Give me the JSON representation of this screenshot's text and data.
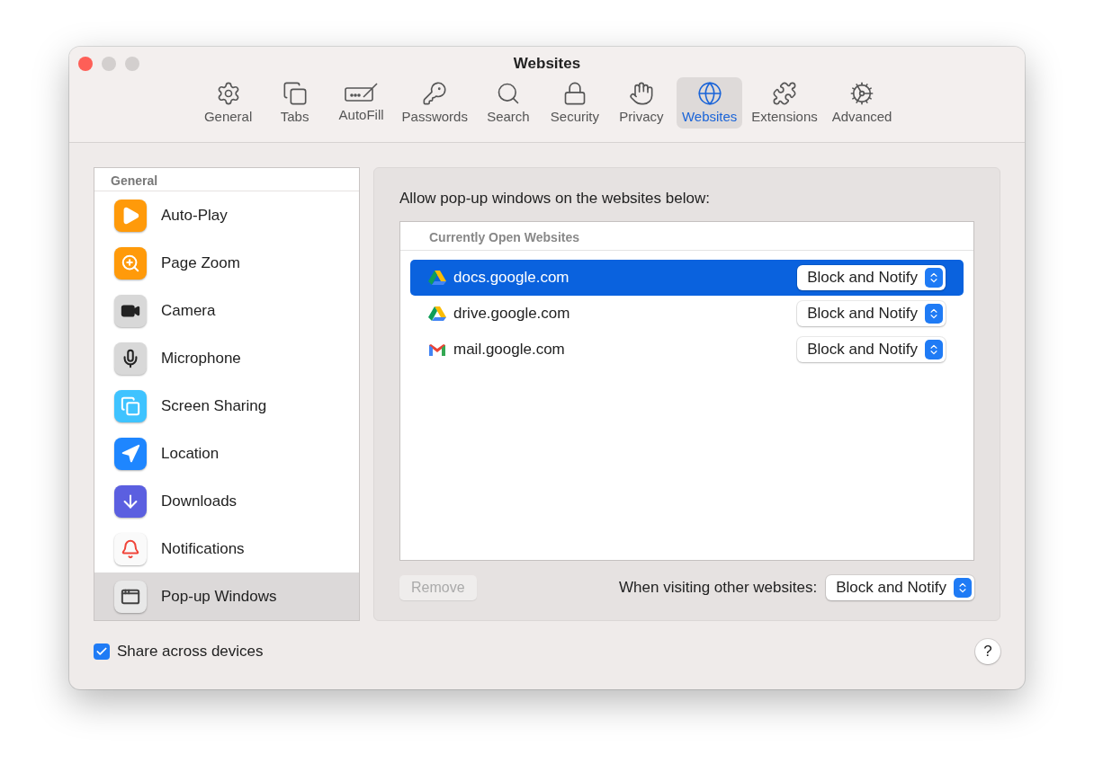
{
  "window": {
    "title": "Websites"
  },
  "tabs": [
    {
      "label": "General",
      "selected": false
    },
    {
      "label": "Tabs",
      "selected": false
    },
    {
      "label": "AutoFill",
      "selected": false
    },
    {
      "label": "Passwords",
      "selected": false
    },
    {
      "label": "Search",
      "selected": false
    },
    {
      "label": "Security",
      "selected": false
    },
    {
      "label": "Privacy",
      "selected": false
    },
    {
      "label": "Websites",
      "selected": true
    },
    {
      "label": "Extensions",
      "selected": false
    },
    {
      "label": "Advanced",
      "selected": false
    }
  ],
  "sidebar": {
    "header": "General",
    "items": [
      {
        "label": "Auto-Play",
        "selected": false
      },
      {
        "label": "Page Zoom",
        "selected": false
      },
      {
        "label": "Camera",
        "selected": false
      },
      {
        "label": "Microphone",
        "selected": false
      },
      {
        "label": "Screen Sharing",
        "selected": false
      },
      {
        "label": "Location",
        "selected": false
      },
      {
        "label": "Downloads",
        "selected": false
      },
      {
        "label": "Notifications",
        "selected": false
      },
      {
        "label": "Pop-up Windows",
        "selected": true
      }
    ]
  },
  "panel": {
    "heading": "Allow pop-up windows on the websites below:",
    "table_header": "Currently Open Websites",
    "rows": [
      {
        "site": "docs.google.com",
        "setting": "Block and Notify",
        "selected": true
      },
      {
        "site": "drive.google.com",
        "setting": "Block and Notify",
        "selected": false
      },
      {
        "site": "mail.google.com",
        "setting": "Block and Notify",
        "selected": false
      }
    ],
    "remove_button": {
      "label": "Remove",
      "disabled": true
    },
    "other_label": "When visiting other websites:",
    "other_setting": "Block and Notify"
  },
  "footer": {
    "share": {
      "label": "Share across devices",
      "checked": true
    },
    "help": "?"
  }
}
